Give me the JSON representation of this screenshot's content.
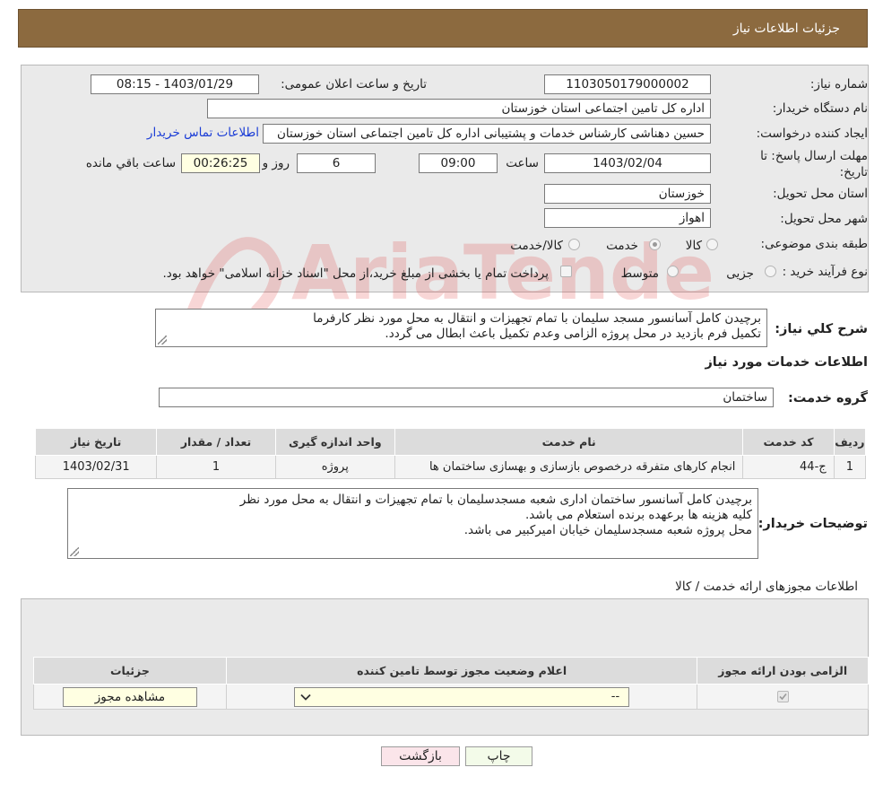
{
  "header": {
    "title": "جزئیات اطلاعات نیاز"
  },
  "form": {
    "need_number_label": "شماره نیاز:",
    "need_number_value": "1103050179000002",
    "announce_label": "تاریخ و ساعت اعلان عمومی:",
    "announce_value": "1403/01/29 - 08:15",
    "buyer_label": "نام دستگاه خریدار:",
    "buyer_value": "اداره کل تامین اجتماعی استان خوزستان",
    "creator_label": "ایجاد کننده درخواست:",
    "creator_value": "حسین دهناشی کارشناس خدمات و پشتیبانی اداره کل تامین اجتماعی استان خوزستان",
    "contact_link": "اطلاعات تماس خریدار",
    "deadline_label_1": "مهلت ارسال پاسخ: تا",
    "deadline_label_2": "تاریخ:",
    "deadline_date": "1403/02/04",
    "time_label": "ساعت",
    "deadline_time": "09:00",
    "days_value": "6",
    "days_label": "روز و",
    "remaining_value": "00:26:25",
    "remaining_label": "ساعت باقي مانده",
    "province_label": "استان محل تحویل:",
    "province_value": "خوزستان",
    "city_label": "شهر محل تحویل:",
    "city_value": "اهواز",
    "category_label": "طبقه بندی موضوعی:",
    "category_options": [
      "کالا",
      "خدمت",
      "کالا/خدمت"
    ],
    "category_selected": "خدمت",
    "process_label": "نوع فرآیند خرید :",
    "process_options": [
      "جزیی",
      "متوسط"
    ],
    "process_note": "پرداخت تمام یا بخشی از مبلغ خرید،از محل \"اسناد خزانه اسلامی\" خواهد بود."
  },
  "summary": {
    "label": "شرح کلي نیاز:",
    "lines": [
      "برچیدن کامل آسانسور مسجد سلیمان با تمام تجهیزات و انتقال به محل مورد نظر کارفرما",
      "تکمیل فرم بازدید در محل پروژه الزامی وعدم تکمیل باعث ابطال می گردد."
    ]
  },
  "services": {
    "section_title": "اطلاعات خدمات مورد نیاز",
    "group_label": "گروه خدمت:",
    "group_value": "ساختمان",
    "columns": [
      "ردیف",
      "کد خدمت",
      "نام خدمت",
      "واحد اندازه گیری",
      "تعداد / مقدار",
      "تاریخ نیاز"
    ],
    "rows": [
      [
        "1",
        "ج-44",
        "انجام کارهای متفرقه درخصوص بازسازی و بهسازی ساختمان ها",
        "پروژه",
        "1",
        "1403/02/31"
      ]
    ]
  },
  "buyer_notes": {
    "label": "توضیحات خریدار:",
    "lines": [
      "برچیدن کامل آسانسور ساختمان اداری شعبه مسجدسلیمان با تمام تجهیزات و انتقال به محل مورد نظر",
      "کلیه هزینه ها برعهده برنده استعلام می باشد.",
      "محل پروژه شعبه مسجدسلیمان خیابان امیرکبیر می باشد."
    ]
  },
  "permits": {
    "section_title": "اطلاعات مجوزهای ارائه خدمت / کالا",
    "columns": [
      "الزامی بودن ارائه مجوز",
      "اعلام وضعیت مجوز توسط تامین کننده",
      "جزئیات"
    ],
    "select_value": "--",
    "view_button": "مشاهده مجوز"
  },
  "actions": {
    "print": "چاپ",
    "back": "بازگشت"
  },
  "watermark": {
    "text": "AriaTender.net"
  }
}
